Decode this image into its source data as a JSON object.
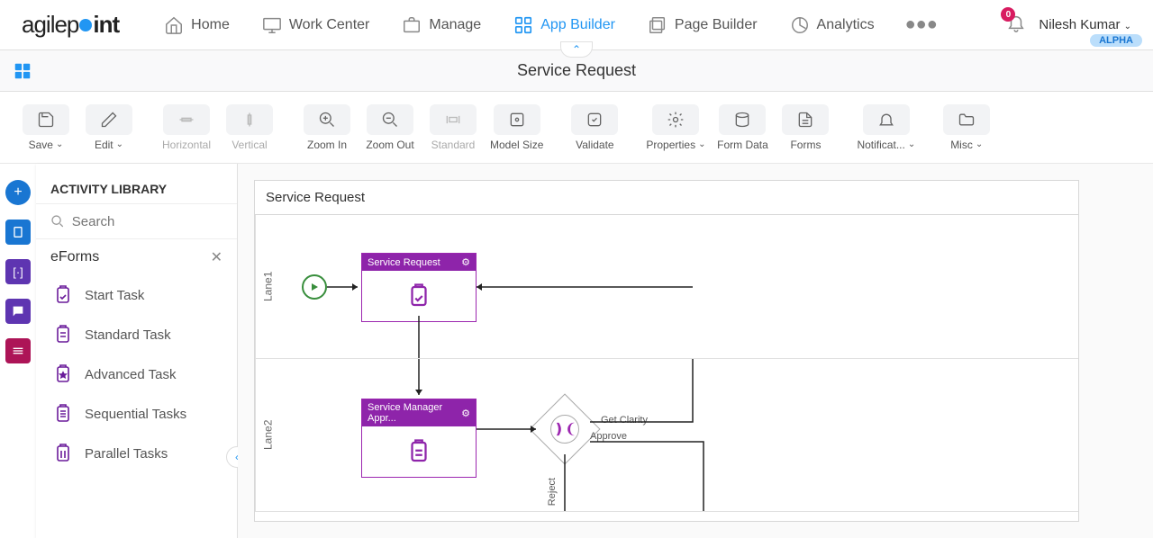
{
  "header": {
    "logo_text_left": "agilep",
    "logo_text_right": "int",
    "nav": [
      {
        "label": "Home",
        "icon": "home"
      },
      {
        "label": "Work Center",
        "icon": "monitor"
      },
      {
        "label": "Manage",
        "icon": "briefcase"
      },
      {
        "label": "App Builder",
        "icon": "grid",
        "active": true
      },
      {
        "label": "Page Builder",
        "icon": "layers"
      },
      {
        "label": "Analytics",
        "icon": "pie"
      }
    ],
    "badge_count": "0",
    "user_name": "Nilesh Kumar",
    "tier": "ALPHA"
  },
  "subheader": {
    "title": "Service Request"
  },
  "toolbar": [
    {
      "label": "Save",
      "dropdown": true,
      "icon": "save"
    },
    {
      "label": "Edit",
      "dropdown": true,
      "icon": "edit"
    },
    {
      "label": "Horizontal",
      "icon": "align-h",
      "disabled": true
    },
    {
      "label": "Vertical",
      "icon": "align-v",
      "disabled": true
    },
    {
      "label": "Zoom In",
      "icon": "zoom-in"
    },
    {
      "label": "Zoom Out",
      "icon": "zoom-out"
    },
    {
      "label": "Standard",
      "icon": "fit",
      "disabled": true
    },
    {
      "label": "Model Size",
      "icon": "size"
    },
    {
      "label": "Validate",
      "icon": "check"
    },
    {
      "label": "Properties",
      "dropdown": true,
      "icon": "gear"
    },
    {
      "label": "Form Data",
      "icon": "db"
    },
    {
      "label": "Forms",
      "icon": "file"
    },
    {
      "label": "Notificat...",
      "dropdown": true,
      "icon": "bell"
    },
    {
      "label": "Misc",
      "dropdown": true,
      "icon": "folder"
    }
  ],
  "sidebar": {
    "title": "ACTIVITY LIBRARY",
    "search_placeholder": "Search",
    "category": "eForms",
    "items": [
      {
        "label": "Start Task"
      },
      {
        "label": "Standard Task"
      },
      {
        "label": "Advanced Task"
      },
      {
        "label": "Sequential Tasks"
      },
      {
        "label": "Parallel Tasks"
      }
    ]
  },
  "canvas": {
    "title": "Service Request",
    "lanes": [
      "Lane1",
      "Lane2"
    ],
    "activities": {
      "a1": "Service Request",
      "a2": "Service Manager Appr..."
    },
    "edges": {
      "e1": "Get Clarity",
      "e2": "Approve",
      "e3": "Reject"
    }
  }
}
